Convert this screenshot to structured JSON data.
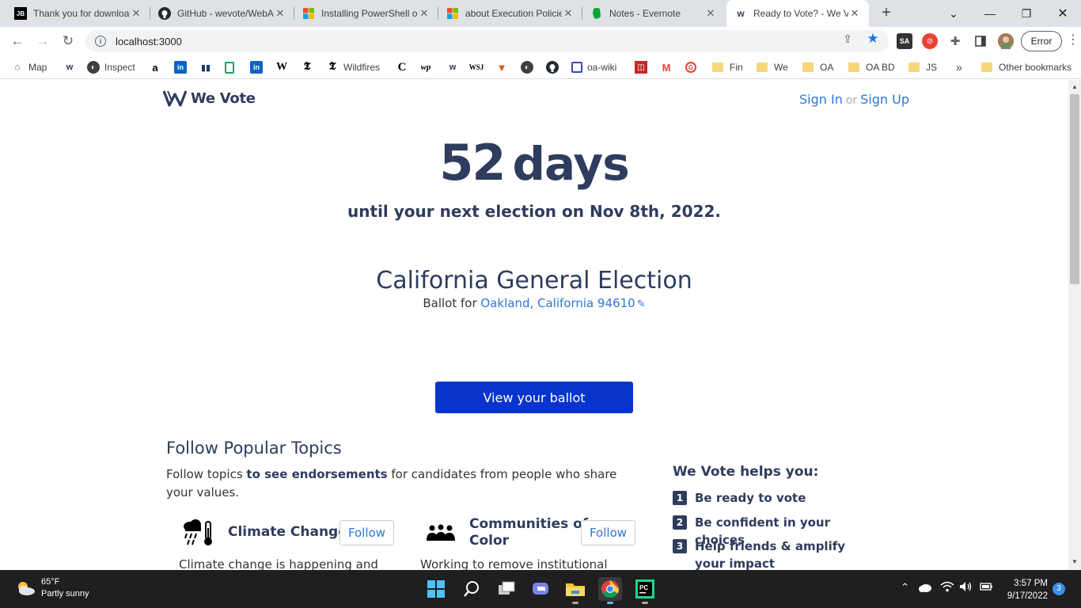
{
  "browser": {
    "tabs": [
      {
        "title": "Thank you for downloading",
        "favicon": "jetbrains-icon",
        "active": false
      },
      {
        "title": "GitHub - wevote/WebApp",
        "favicon": "github-icon",
        "active": false
      },
      {
        "title": "Installing PowerShell on Windows",
        "favicon": "microsoft-icon",
        "active": false
      },
      {
        "title": "about Execution Policies",
        "favicon": "microsoft-icon",
        "active": false
      },
      {
        "title": "Notes - Evernote",
        "favicon": "evernote-icon",
        "active": false
      },
      {
        "title": "Ready to Vote? - We Vote",
        "favicon": "wevote-icon",
        "active": true
      }
    ],
    "url": "localhost:3000",
    "error_label": "Error",
    "bookmarks": [
      {
        "label": "Map",
        "icon": "map-icon"
      },
      {
        "label": "",
        "icon": "wevote-icon"
      },
      {
        "label": "Inspect",
        "icon": "globe-icon"
      },
      {
        "label": "",
        "icon": "amazon-icon"
      },
      {
        "label": "",
        "icon": "linkedin-icon"
      },
      {
        "label": "",
        "icon": "bars-icon"
      },
      {
        "label": "",
        "icon": "green-doc-icon"
      },
      {
        "label": "",
        "icon": "linkedin-icon"
      },
      {
        "label": "",
        "icon": "wikipedia-icon"
      },
      {
        "label": "",
        "icon": "nyt-icon"
      },
      {
        "label": "Wildfires",
        "icon": "nyt-icon"
      },
      {
        "label": "",
        "icon": "c-icon"
      },
      {
        "label": "",
        "icon": "wapo-icon"
      },
      {
        "label": "",
        "icon": "wevote-icon"
      },
      {
        "label": "",
        "icon": "wsj-icon"
      },
      {
        "label": "",
        "icon": "flag-icon"
      },
      {
        "label": "",
        "icon": "globe-icon"
      },
      {
        "label": "",
        "icon": "github-icon"
      },
      {
        "label": "oa-wiki",
        "icon": "wiki-icon"
      },
      {
        "label": "",
        "icon": "red-square-icon"
      },
      {
        "label": "",
        "icon": "gmail-icon"
      },
      {
        "label": "",
        "icon": "grammarly-icon"
      },
      {
        "label": "Fin",
        "icon": "folder-icon"
      },
      {
        "label": "We",
        "icon": "folder-icon"
      },
      {
        "label": "OA",
        "icon": "folder-icon"
      },
      {
        "label": "OA BD",
        "icon": "folder-icon"
      },
      {
        "label": "JS",
        "icon": "folder-icon"
      }
    ],
    "more_bookmarks": "»",
    "other_bookmarks": "Other bookmarks"
  },
  "page": {
    "brand": "We Vote",
    "sign_in": "Sign In",
    "or": "or",
    "sign_up": "Sign Up",
    "days_number": "52",
    "days_unit": "days",
    "until_text": "until your next election on Nov 8th, 2022.",
    "election_name": "California General Election",
    "ballot_for": "Ballot for",
    "ballot_location": "Oakland, California 94610",
    "view_ballot": "View your ballot",
    "topics_title": "Follow Popular Topics",
    "topics_desc_pre": "Follow topics",
    "topics_desc_bold": "to see endorsements",
    "topics_desc_post": "for candidates from people who share your values.",
    "topics": [
      {
        "name": "Climate Change",
        "follow": "Follow",
        "desc": "Climate change is happening and"
      },
      {
        "name_line1": "Communities of",
        "name_line2": "Color",
        "follow": "Follow",
        "desc": "Working to remove institutional"
      }
    ],
    "helps_title": "We Vote helps you:",
    "helps": [
      {
        "num": "1",
        "text": "Be ready to vote"
      },
      {
        "num": "2",
        "text": "Be confident in your choices"
      },
      {
        "num": "3",
        "text": "Help friends & amplify your impact"
      }
    ]
  },
  "taskbar": {
    "weather_temp": "65°F",
    "weather_desc": "Partly sunny",
    "time": "3:57 PM",
    "date": "9/17/2022",
    "notifications": "3"
  },
  "colors": {
    "brand_navy": "#2e3c5d",
    "link_blue": "#2e78d2",
    "button_blue": "#0834cd"
  }
}
